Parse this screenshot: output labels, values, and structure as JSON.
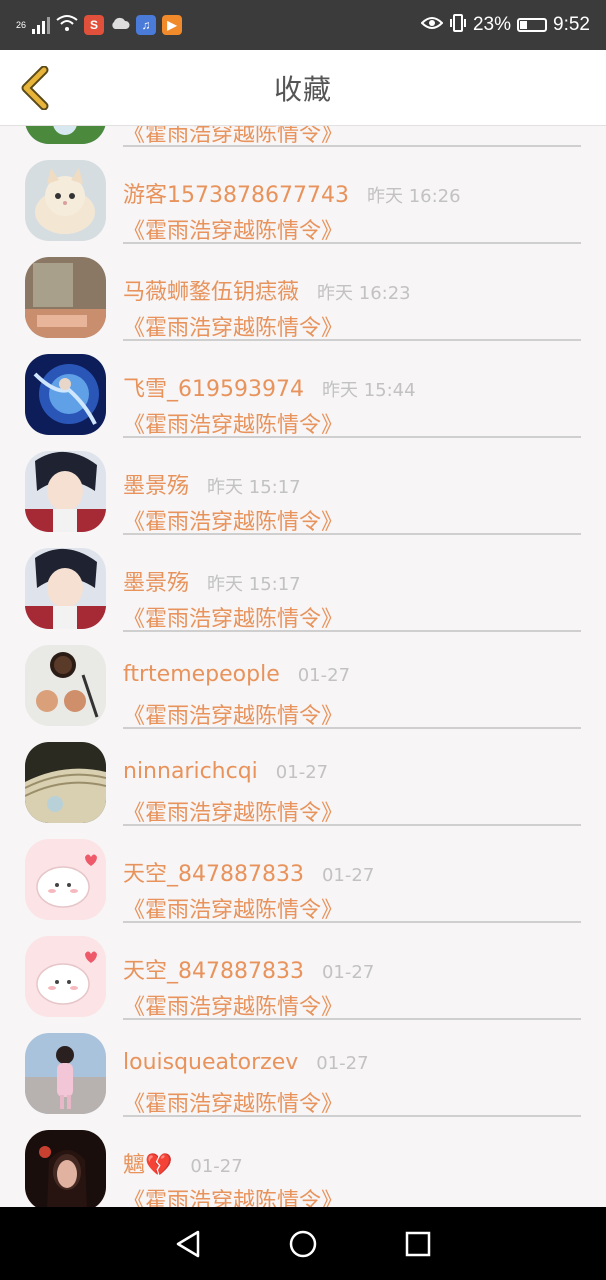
{
  "status_bar": {
    "network": "26",
    "battery_percent": "23%",
    "time": "9:52",
    "icons": [
      "signal-icon",
      "wifi-icon",
      "weibo-icon",
      "cloud-icon",
      "music-icon",
      "video-icon",
      "eye-icon",
      "vibrate-icon",
      "battery-icon"
    ]
  },
  "header": {
    "title": "收藏",
    "back_icon": "chevron-left-icon",
    "accent": "#e8b43a"
  },
  "partial_row": {
    "book": "《霍雨浩穿越陈情令》"
  },
  "rows": [
    {
      "name": "游客1573878677743",
      "time": "昨天 16:26",
      "book": "《霍雨浩穿越陈情令》",
      "avatar": "kitten"
    },
    {
      "name": "马薇蛳鍪伍钥痣薇",
      "time": "昨天 16:23",
      "book": "《霍雨浩穿越陈情令》",
      "avatar": "bedroom"
    },
    {
      "name": "飞雪_619593974",
      "time": "昨天 15:44",
      "book": "《霍雨浩穿越陈情令》",
      "avatar": "blue-fantasy"
    },
    {
      "name": "墨景殇",
      "time": "昨天 15:17",
      "book": "《霍雨浩穿越陈情令》",
      "avatar": "anime-boy"
    },
    {
      "name": "墨景殇",
      "time": "昨天 15:17",
      "book": "《霍雨浩穿越陈情令》",
      "avatar": "anime-boy"
    },
    {
      "name": "ftrtemepeople",
      "time": "01-27",
      "book": "《霍雨浩穿越陈情令》",
      "avatar": "coffee"
    },
    {
      "name": "ninnarichcqi",
      "time": "01-27",
      "book": "《霍雨浩穿越陈情令》",
      "avatar": "book"
    },
    {
      "name": "天空_847887833",
      "time": "01-27",
      "book": "《霍雨浩穿越陈情令》",
      "avatar": "cute-cat"
    },
    {
      "name": "天空_847887833",
      "time": "01-27",
      "book": "《霍雨浩穿越陈情令》",
      "avatar": "cute-cat"
    },
    {
      "name": "louisqueatorzev",
      "time": "01-27",
      "book": "《霍雨浩穿越陈情令》",
      "avatar": "girl"
    },
    {
      "name": "魑💔",
      "time": "01-27",
      "book": "《霍雨浩穿越陈情令》",
      "avatar": "dark-girl"
    }
  ],
  "nav_bar": {
    "icons": [
      "back-triangle-icon",
      "home-circle-icon",
      "recents-square-icon"
    ]
  },
  "colors": {
    "name": "#e8935c",
    "time": "#c2c2c2",
    "status_bar": "#3b3b3b",
    "background": "#f7f5f5"
  }
}
